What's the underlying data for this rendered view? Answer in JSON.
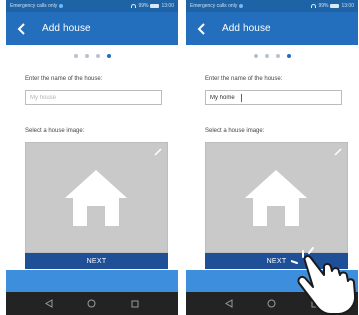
{
  "screens": [
    {
      "status": {
        "left_text": "Emergency calls only",
        "right_text": "99%",
        "time": "13:00"
      },
      "app_bar": {
        "title": "Add house"
      },
      "wizard": {
        "total_steps": 4,
        "active_step": 4
      },
      "form": {
        "name_label": "Enter the name of the house:",
        "name_value": "",
        "name_placeholder": "My house",
        "image_label": "Select a house image:",
        "next_label": "NEXT"
      }
    },
    {
      "status": {
        "left_text": "Emergency calls only",
        "right_text": "99%",
        "time": "13:00"
      },
      "app_bar": {
        "title": "Add house"
      },
      "wizard": {
        "total_steps": 4,
        "active_step": 4
      },
      "form": {
        "name_label": "Enter the name of the house:",
        "name_value": "My home",
        "name_placeholder": "My house",
        "image_label": "Select a house image:",
        "next_label": "NEXT"
      }
    }
  ],
  "colors": {
    "status_bar": "#1d63a6",
    "app_bar": "#246fbd",
    "next_button": "#1f4f96",
    "image_box": "#c9c9c9",
    "bottom_band": "#3d8edc",
    "nav_bar": "#232323"
  },
  "icons": {
    "back": "back-arrow-icon",
    "edit": "pencil-icon",
    "house": "house-icon",
    "nav_back": "triangle-back-icon",
    "nav_home": "circle-home-icon",
    "nav_recent": "square-recent-icon",
    "gesture": "tap-hand-icon"
  }
}
